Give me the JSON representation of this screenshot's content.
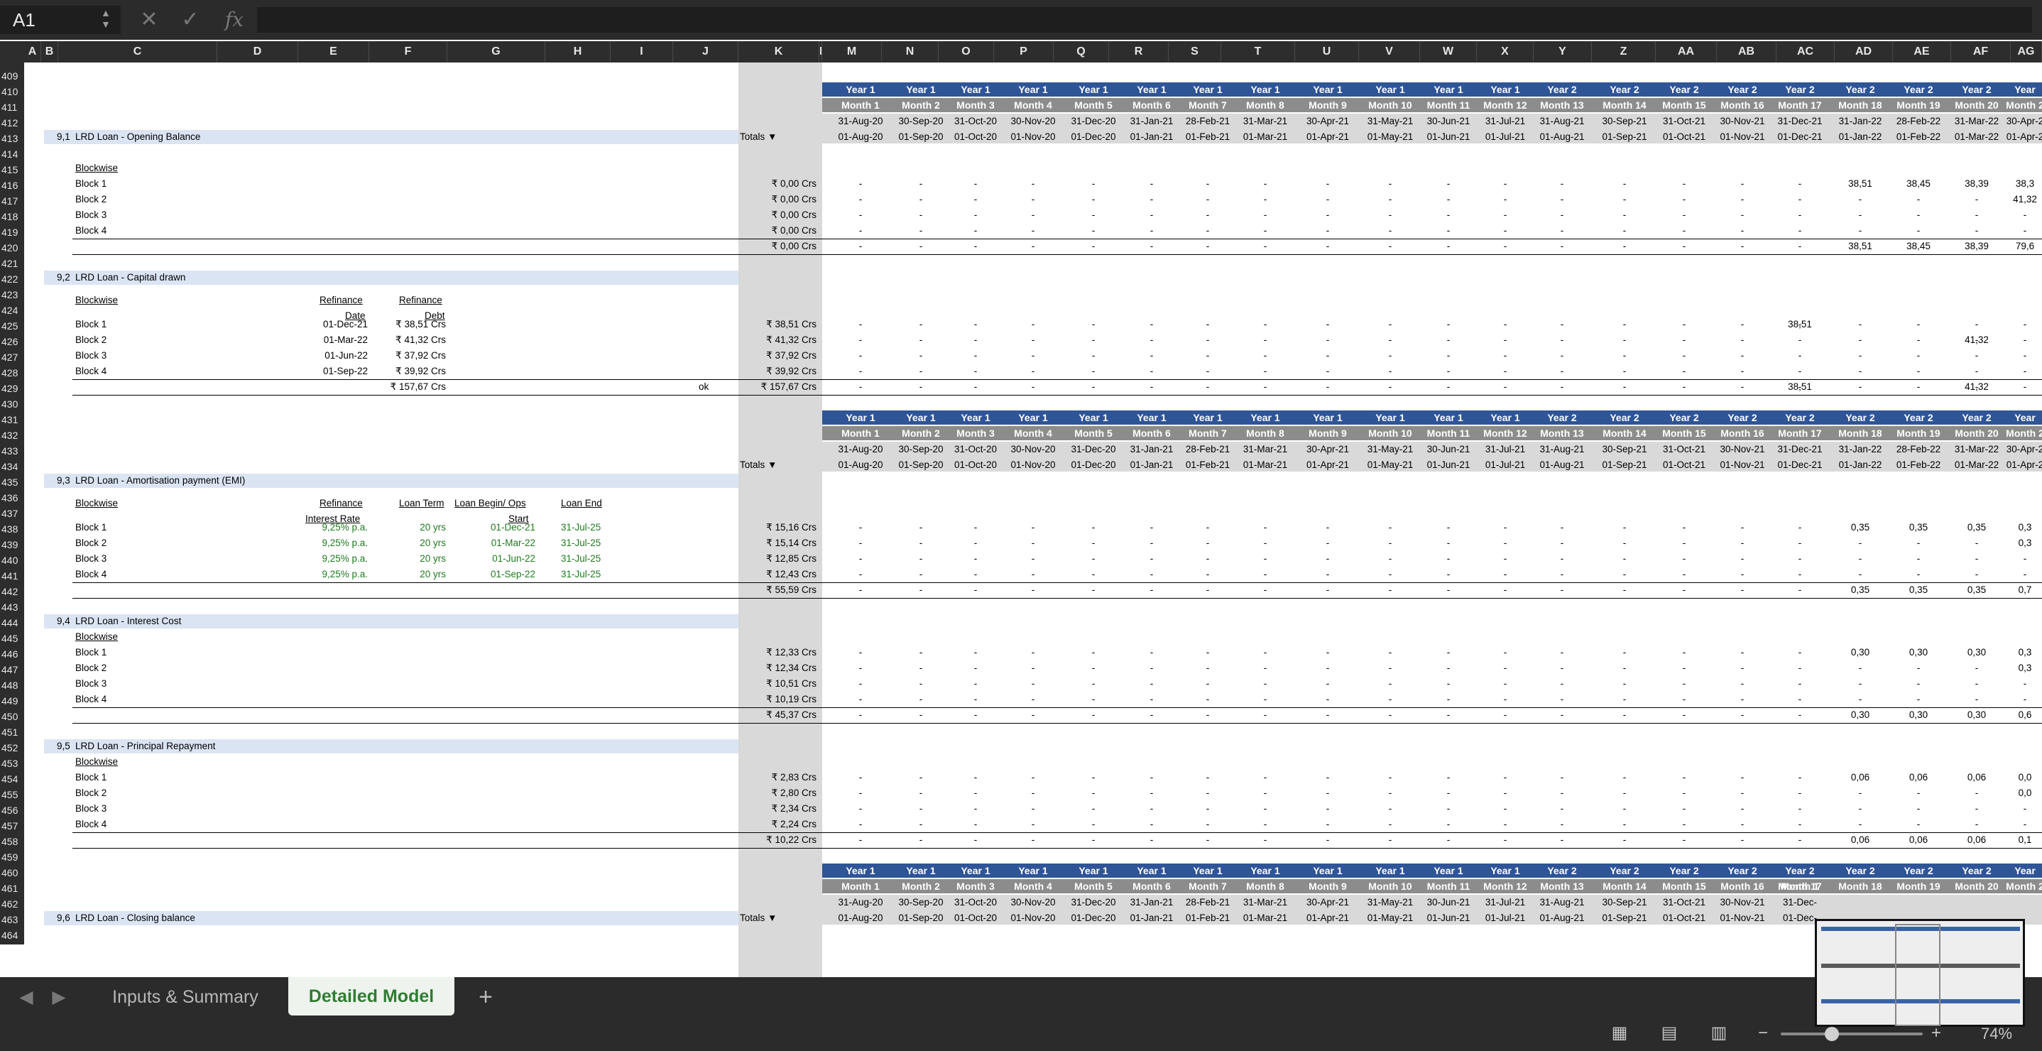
{
  "namebox": "A1",
  "formula_bar": {
    "value": ""
  },
  "columns": [
    "A",
    "B",
    "C",
    "D",
    "E",
    "F",
    "G",
    "H",
    "I",
    "J",
    "K",
    "L",
    "M",
    "N",
    "O",
    "P",
    "Q",
    "R",
    "S",
    "T",
    "U",
    "V",
    "W",
    "X",
    "Y",
    "Z",
    "AA",
    "AB",
    "AC",
    "AD",
    "AE",
    "AF",
    "AG"
  ],
  "rows": [
    "409",
    "410",
    "411",
    "412",
    "413",
    "414",
    "415",
    "416",
    "417",
    "418",
    "419",
    "420",
    "421",
    "422",
    "423",
    "424",
    "425",
    "426",
    "427",
    "428",
    "429",
    "430",
    "431",
    "432",
    "433",
    "434",
    "435",
    "436",
    "437",
    "438",
    "439",
    "440",
    "441",
    "442",
    "443",
    "444",
    "445",
    "446",
    "447",
    "448",
    "449",
    "450",
    "451",
    "452",
    "453",
    "454",
    "455",
    "456",
    "457",
    "458",
    "459",
    "460",
    "461",
    "462",
    "463",
    "464"
  ],
  "timeline": {
    "years": [
      "Year 1",
      "Year 1",
      "Year 1",
      "Year 1",
      "Year 1",
      "Year 1",
      "Year 1",
      "Year 1",
      "Year 1",
      "Year 1",
      "Year 1",
      "Year 1",
      "Year 2",
      "Year 2",
      "Year 2",
      "Year 2",
      "Year 2",
      "Year 2",
      "Year 2",
      "Year 2",
      "Year 2"
    ],
    "months": [
      "Month 1",
      "Month 2",
      "Month 3",
      "Month 4",
      "Month 5",
      "Month 6",
      "Month 7",
      "Month 8",
      "Month 9",
      "Month 10",
      "Month 11",
      "Month 12",
      "Month 13",
      "Month 14",
      "Month 15",
      "Month 16",
      "Month 17",
      "Month 18",
      "Month 19",
      "Month 20",
      "Month 2"
    ],
    "end_dates": [
      "31-Aug-20",
      "30-Sep-20",
      "31-Oct-20",
      "30-Nov-20",
      "31-Dec-20",
      "31-Jan-21",
      "28-Feb-21",
      "31-Mar-21",
      "30-Apr-21",
      "31-May-21",
      "30-Jun-21",
      "31-Jul-21",
      "31-Aug-21",
      "30-Sep-21",
      "31-Oct-21",
      "30-Nov-21",
      "31-Dec-21",
      "31-Jan-22",
      "28-Feb-22",
      "31-Mar-22",
      "30-Apr-2"
    ],
    "start_dates": [
      "01-Aug-20",
      "01-Sep-20",
      "01-Oct-20",
      "01-Nov-20",
      "01-Dec-20",
      "01-Jan-21",
      "01-Feb-21",
      "01-Mar-21",
      "01-Apr-21",
      "01-May-21",
      "01-Jun-21",
      "01-Jul-21",
      "01-Aug-21",
      "01-Sep-21",
      "01-Oct-21",
      "01-Nov-21",
      "01-Dec-21",
      "01-Jan-22",
      "01-Feb-22",
      "01-Mar-22",
      "01-Apr-2"
    ],
    "last_year_label": "Year",
    "last_month_label": "Month 2",
    "third_header_last_month": "Month 1",
    "third_header_last_end": "31-Dec-",
    "third_header_last_start": "01-Dec-"
  },
  "totals_label": "Totals ▼",
  "blockwise_label": "Blockwise",
  "sections": {
    "s91": {
      "num": "9,1",
      "title": "LRD Loan - Opening Balance",
      "rows": [
        {
          "label": "Block 1",
          "total": "₹ 0,00 Crs",
          "tail": [
            "38,51",
            "38,45",
            "38,39",
            "38,3"
          ]
        },
        {
          "label": "Block 2",
          "total": "₹ 0,00 Crs",
          "tail": [
            "-",
            "-",
            "-",
            "41,32"
          ]
        },
        {
          "label": "Block 3",
          "total": "₹ 0,00 Crs",
          "tail": [
            "-",
            "-",
            "-",
            "-"
          ]
        },
        {
          "label": "Block 4",
          "total": "₹ 0,00 Crs",
          "tail": [
            "-",
            "-",
            "-",
            "-"
          ]
        }
      ],
      "sum": {
        "total": "₹ 0,00 Crs",
        "tail": [
          "38,51",
          "38,45",
          "38,39",
          "79,6"
        ]
      }
    },
    "s92": {
      "num": "9,2",
      "title": "LRD Loan - Capital drawn",
      "col_date_1": "Refinance",
      "col_date_2": "Date",
      "col_debt_1": "Refinance",
      "col_debt_2": "Debt",
      "rows": [
        {
          "label": "Block 1",
          "date": "01-Dec-21",
          "debt": "₹ 38,51 Crs",
          "total": "₹ 38,51 Crs"
        },
        {
          "label": "Block 2",
          "date": "01-Mar-22",
          "debt": "₹ 41,32 Crs",
          "total": "₹ 41,32 Crs"
        },
        {
          "label": "Block 3",
          "date": "01-Jun-22",
          "debt": "₹ 37,92 Crs",
          "total": "₹ 37,92 Crs"
        },
        {
          "label": "Block 4",
          "date": "01-Sep-22",
          "debt": "₹ 39,92 Crs",
          "total": "₹ 39,92 Crs"
        }
      ],
      "sum": {
        "debt": "₹ 157,67 Crs",
        "check": "ok",
        "total": "₹ 157,67 Crs"
      },
      "b1_value": "38,51",
      "b2_value": "41,32",
      "sum_v1": "38,51",
      "sum_v2": "41,32"
    },
    "s93": {
      "num": "9,3",
      "title": "LRD Loan - Amortisation payment (EMI)",
      "col_rate_1": "Refinance",
      "col_rate_2": "Interest Rate",
      "col_term": "Loan Term",
      "col_begin_1": "Loan Begin/ Ops",
      "col_begin_2": "Start",
      "col_end": "Loan End",
      "rows": [
        {
          "label": "Block 1",
          "rate": "9,25% p.a.",
          "term": "20 yrs",
          "begin": "01-Dec-21",
          "end": "31-Jul-25",
          "total": "₹ 15,16 Crs",
          "tail": [
            "0,35",
            "0,35",
            "0,35",
            "0,3"
          ]
        },
        {
          "label": "Block 2",
          "rate": "9,25% p.a.",
          "term": "20 yrs",
          "begin": "01-Mar-22",
          "end": "31-Jul-25",
          "total": "₹ 15,14 Crs",
          "tail": [
            "-",
            "-",
            "-",
            "0,3"
          ]
        },
        {
          "label": "Block 3",
          "rate": "9,25% p.a.",
          "term": "20 yrs",
          "begin": "01-Jun-22",
          "end": "31-Jul-25",
          "total": "₹ 12,85 Crs",
          "tail": [
            "-",
            "-",
            "-",
            "-"
          ]
        },
        {
          "label": "Block 4",
          "rate": "9,25% p.a.",
          "term": "20 yrs",
          "begin": "01-Sep-22",
          "end": "31-Jul-25",
          "total": "₹ 12,43 Crs",
          "tail": [
            "-",
            "-",
            "-",
            "-"
          ]
        }
      ],
      "sum": {
        "total": "₹ 55,59 Crs",
        "tail": [
          "0,35",
          "0,35",
          "0,35",
          "0,7"
        ]
      }
    },
    "s94": {
      "num": "9,4",
      "title": "LRD Loan - Interest Cost",
      "rows": [
        {
          "label": "Block 1",
          "total": "₹ 12,33 Crs",
          "tail": [
            "0,30",
            "0,30",
            "0,30",
            "0,3"
          ]
        },
        {
          "label": "Block 2",
          "total": "₹ 12,34 Crs",
          "tail": [
            "-",
            "-",
            "-",
            "0,3"
          ]
        },
        {
          "label": "Block 3",
          "total": "₹ 10,51 Crs",
          "tail": [
            "-",
            "-",
            "-",
            "-"
          ]
        },
        {
          "label": "Block 4",
          "total": "₹ 10,19 Crs",
          "tail": [
            "-",
            "-",
            "-",
            "-"
          ]
        }
      ],
      "sum": {
        "total": "₹ 45,37 Crs",
        "tail": [
          "0,30",
          "0,30",
          "0,30",
          "0,6"
        ]
      }
    },
    "s95": {
      "num": "9,5",
      "title": "LRD Loan - Principal Repayment",
      "rows": [
        {
          "label": "Block 1",
          "total": "₹ 2,83 Crs",
          "tail": [
            "0,06",
            "0,06",
            "0,06",
            "0,0"
          ]
        },
        {
          "label": "Block 2",
          "total": "₹ 2,80 Crs",
          "tail": [
            "-",
            "-",
            "-",
            "0,0"
          ]
        },
        {
          "label": "Block 3",
          "total": "₹ 2,34 Crs",
          "tail": [
            "-",
            "-",
            "-",
            "-"
          ]
        },
        {
          "label": "Block 4",
          "total": "₹ 2,24 Crs",
          "tail": [
            "-",
            "-",
            "-",
            "-"
          ]
        }
      ],
      "sum": {
        "total": "₹ 10,22 Crs",
        "tail": [
          "0,06",
          "0,06",
          "0,06",
          "0,1"
        ]
      }
    },
    "s96": {
      "num": "9,6",
      "title": "LRD Loan - Closing balance"
    }
  },
  "tabs": {
    "inputs": "Inputs & Summary",
    "detailed": "Detailed Model",
    "add": "+"
  },
  "zoom": "74%",
  "colors": {
    "year_header": "#2f5597",
    "month_header": "#8c8c8c",
    "section_fill": "#dbe4f3",
    "input_green": "#1f7a1f",
    "active_tab": "#2f7d32"
  }
}
